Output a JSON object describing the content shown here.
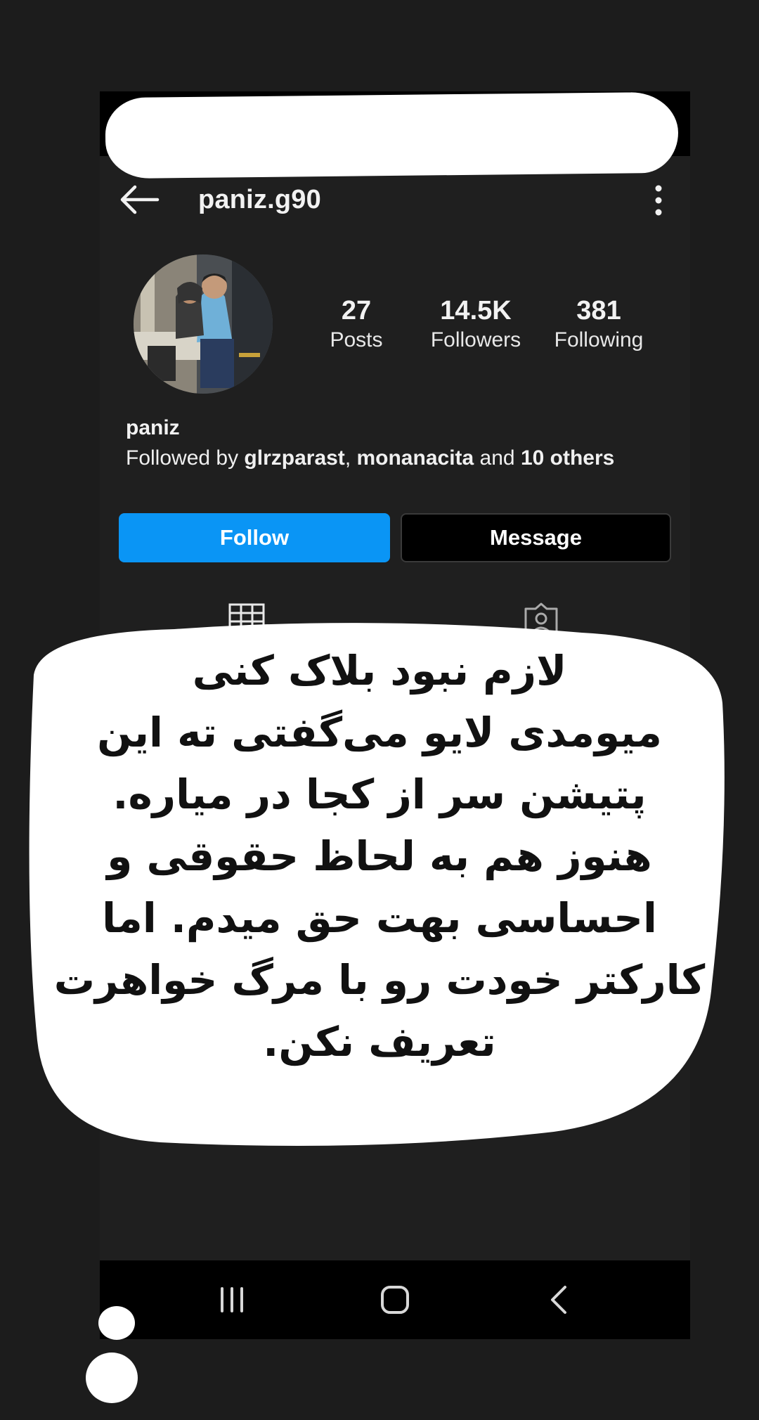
{
  "profile": {
    "username": "paniz.g90",
    "display_name": "paniz",
    "stats": {
      "posts_count": "27",
      "posts_label": "Posts",
      "followers_count": "14.5K",
      "followers_label": "Followers",
      "following_count": "381",
      "following_label": "Following"
    },
    "followed_by": {
      "prefix": "Followed by ",
      "user1": "glrzparast",
      "sep": ", ",
      "user2": "monanacita",
      "and": " and ",
      "others": "10 others"
    }
  },
  "actions": {
    "follow_label": "Follow",
    "message_label": "Message"
  },
  "icons": {
    "back": "arrow-left-icon",
    "more": "more-vertical-icon",
    "grid_tab": "grid-icon",
    "tagged_tab": "tagged-person-icon",
    "nav_recents": "recents-icon",
    "nav_home": "home-icon",
    "nav_back": "chevron-left-icon"
  },
  "colors": {
    "follow_button": "#0a95f5",
    "background": "#1f1f1f",
    "note_background": "#ffffff"
  },
  "note": {
    "lines": [
      "لازم نبود بلاک کنی",
      "میومدی لایو می‌گفتی ته این",
      "پتیشن سر از کجا در میاره.",
      "هنوز هم به لحاظ حقوقی و",
      "احساسی بهت حق میدم. اما",
      "کارکتر خودت رو با مرگ خواهرت",
      "تعریف نکن."
    ]
  }
}
